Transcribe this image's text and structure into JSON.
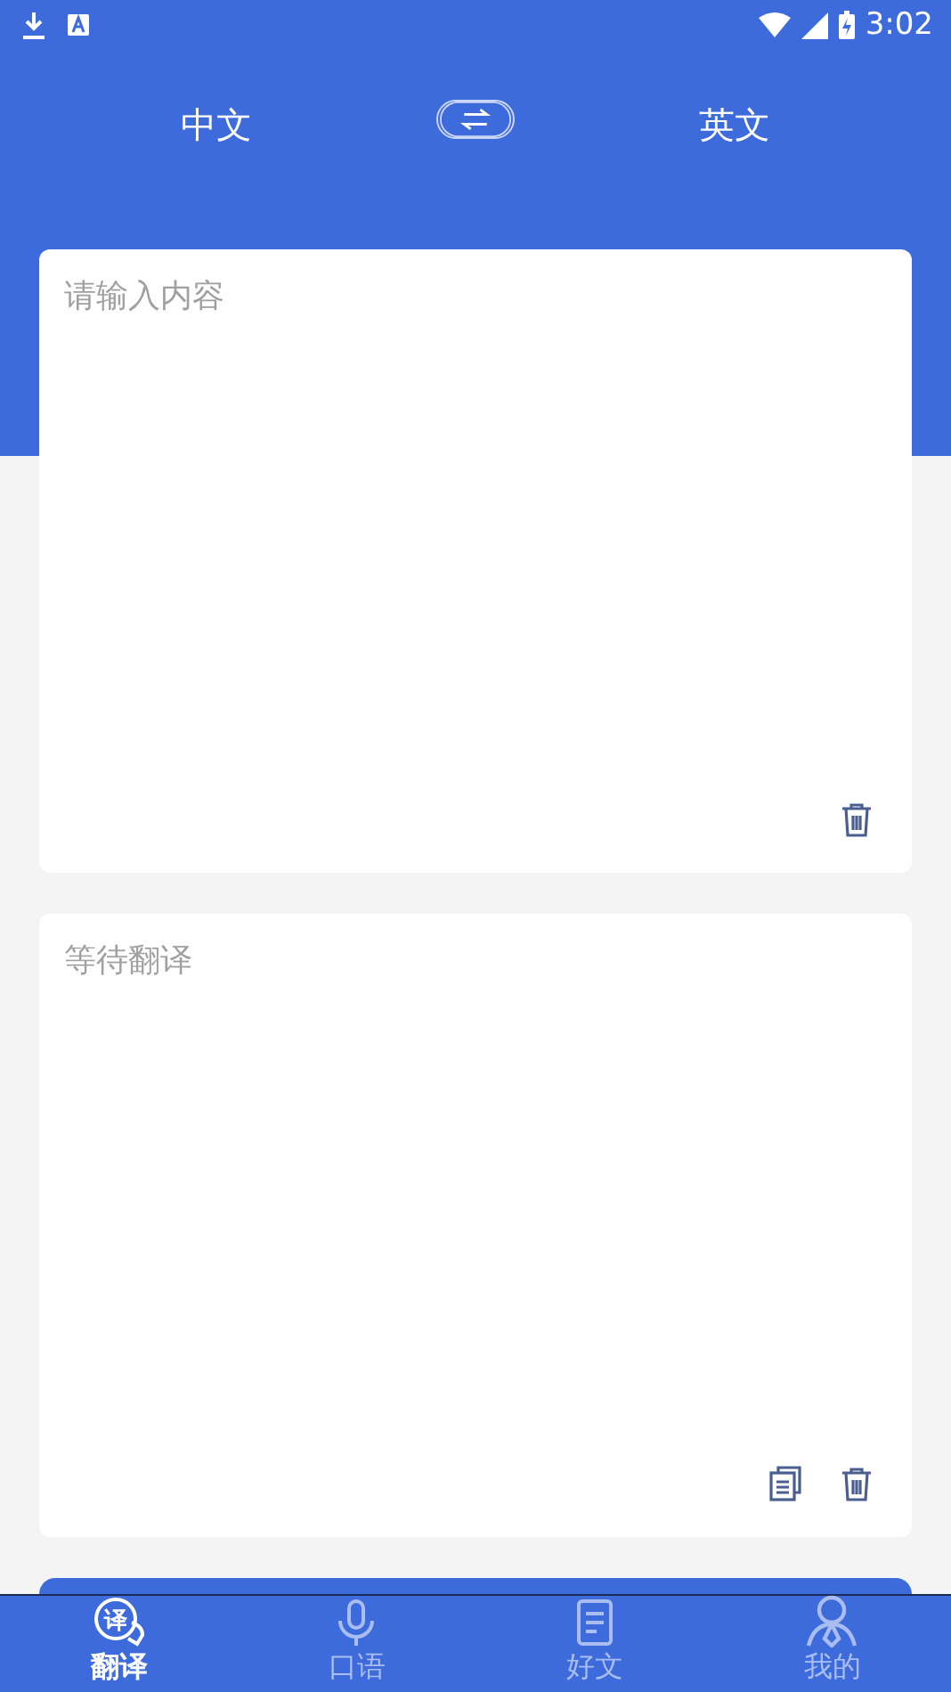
{
  "status_bar": {
    "time": "3:02"
  },
  "languages": {
    "source": "中文",
    "target": "英文"
  },
  "input_card": {
    "placeholder": "请输入内容",
    "actions": [
      {
        "kind": "delete"
      }
    ]
  },
  "output_card": {
    "placeholder": "等待翻译",
    "actions": [
      {
        "kind": "copy"
      },
      {
        "kind": "delete"
      }
    ]
  },
  "tabs": [
    {
      "label": "翻译",
      "selected": true,
      "kind": "translate",
      "icon_glyph": "译"
    },
    {
      "label": "口语",
      "selected": false,
      "kind": "speak"
    },
    {
      "label": "好文",
      "selected": false,
      "kind": "article"
    },
    {
      "label": "我的",
      "selected": false,
      "kind": "profile"
    }
  ]
}
